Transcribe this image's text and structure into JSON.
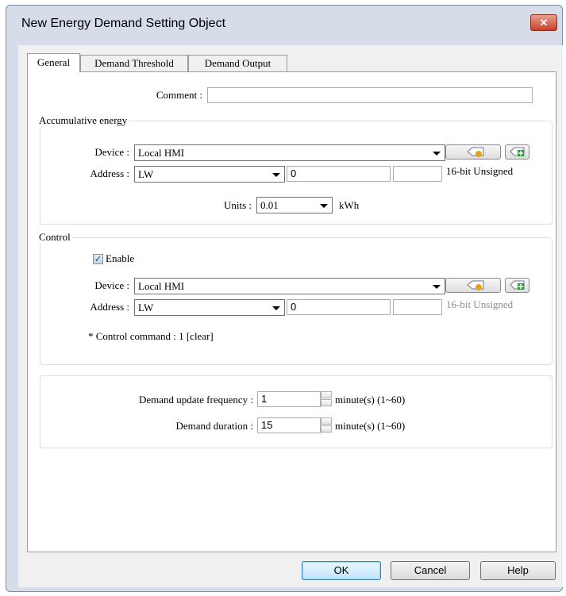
{
  "window": {
    "title": "New Energy Demand Setting Object",
    "close_label": "✕"
  },
  "tabs": [
    {
      "label": "General"
    },
    {
      "label": "Demand Threshold"
    },
    {
      "label": "Demand Output"
    }
  ],
  "comment": {
    "label": "Comment :",
    "value": ""
  },
  "accumulative": {
    "group_title": "Accumulative energy",
    "device_label": "Device :",
    "device_value": "Local HMI",
    "address_label": "Address :",
    "address_type": "LW",
    "address_value": "0",
    "address_extra": "",
    "format": "16-bit Unsigned",
    "units_label": "Units :",
    "units_value": "0.01",
    "units_suffix": "kWh"
  },
  "control": {
    "group_title": "Control",
    "enable_label": "Enable",
    "enable_checked": true,
    "device_label": "Device :",
    "device_value": "Local HMI",
    "address_label": "Address :",
    "address_type": "LW",
    "address_value": "0",
    "address_extra": "",
    "format": "16-bit Unsigned",
    "note": "* Control command : 1 [clear]"
  },
  "demand": {
    "update_label": "Demand update frequency :",
    "update_value": "1",
    "update_suffix": "minute(s) (1~60)",
    "duration_label": "Demand duration :",
    "duration_value": "15",
    "duration_suffix": "minute(s) (1~60)"
  },
  "buttons": {
    "ok": "OK",
    "cancel": "Cancel",
    "help": "Help"
  },
  "colors": {
    "accent": "#3c7fb1",
    "close": "#c9412a",
    "chrome": "#d6dde8"
  },
  "icons": [
    "settings-tag-icon",
    "add-tag-icon",
    "combo-arrow-icon",
    "spin-up-icon",
    "spin-down-icon",
    "check-icon"
  ]
}
